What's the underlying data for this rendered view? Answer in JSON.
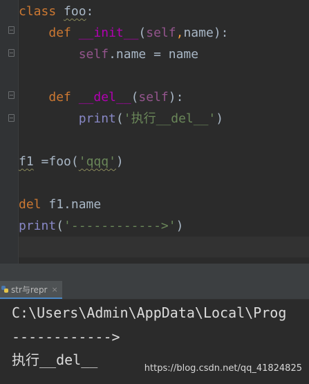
{
  "editor": {
    "line1": {
      "kw": "class",
      "name": "foo",
      "colon": ":"
    },
    "line2": {
      "kw": "def",
      "fn": "__init__",
      "open": "(",
      "self": "self",
      "comma": ",",
      "param": "name",
      "close": "):"
    },
    "line3": {
      "self": "self",
      "rest": ".name = name"
    },
    "line5": {
      "kw": "def",
      "fn": "__del__",
      "open": "(",
      "self": "self",
      "close": "):"
    },
    "line6": {
      "builtin": "print",
      "open": "(",
      "str": "'执行__del__'",
      "close": ")"
    },
    "line8": {
      "var": "f1",
      "eq": " =",
      "call": "foo(",
      "str": "'qqq'",
      "close": ")"
    },
    "line10": {
      "kw": "del",
      "rest": " f1.name"
    },
    "line11": {
      "builtin": "print",
      "open": "(",
      "str": "'------------>'",
      "close": ")"
    }
  },
  "run_tab": {
    "icon": "python-icon",
    "label": "str与repr",
    "close": "×"
  },
  "console": {
    "line1": "C:\\Users\\Admin\\AppData\\Local\\Prog",
    "line2": "------------>",
    "line3": "执行__del__"
  },
  "watermark": "https://blog.csdn.net/qq_41824825",
  "colors": {
    "background": "#2b2b2b",
    "keyword": "#cc7832",
    "function": "#b200b2",
    "self": "#94558d",
    "string": "#6a8759",
    "builtin": "#8888c6"
  }
}
